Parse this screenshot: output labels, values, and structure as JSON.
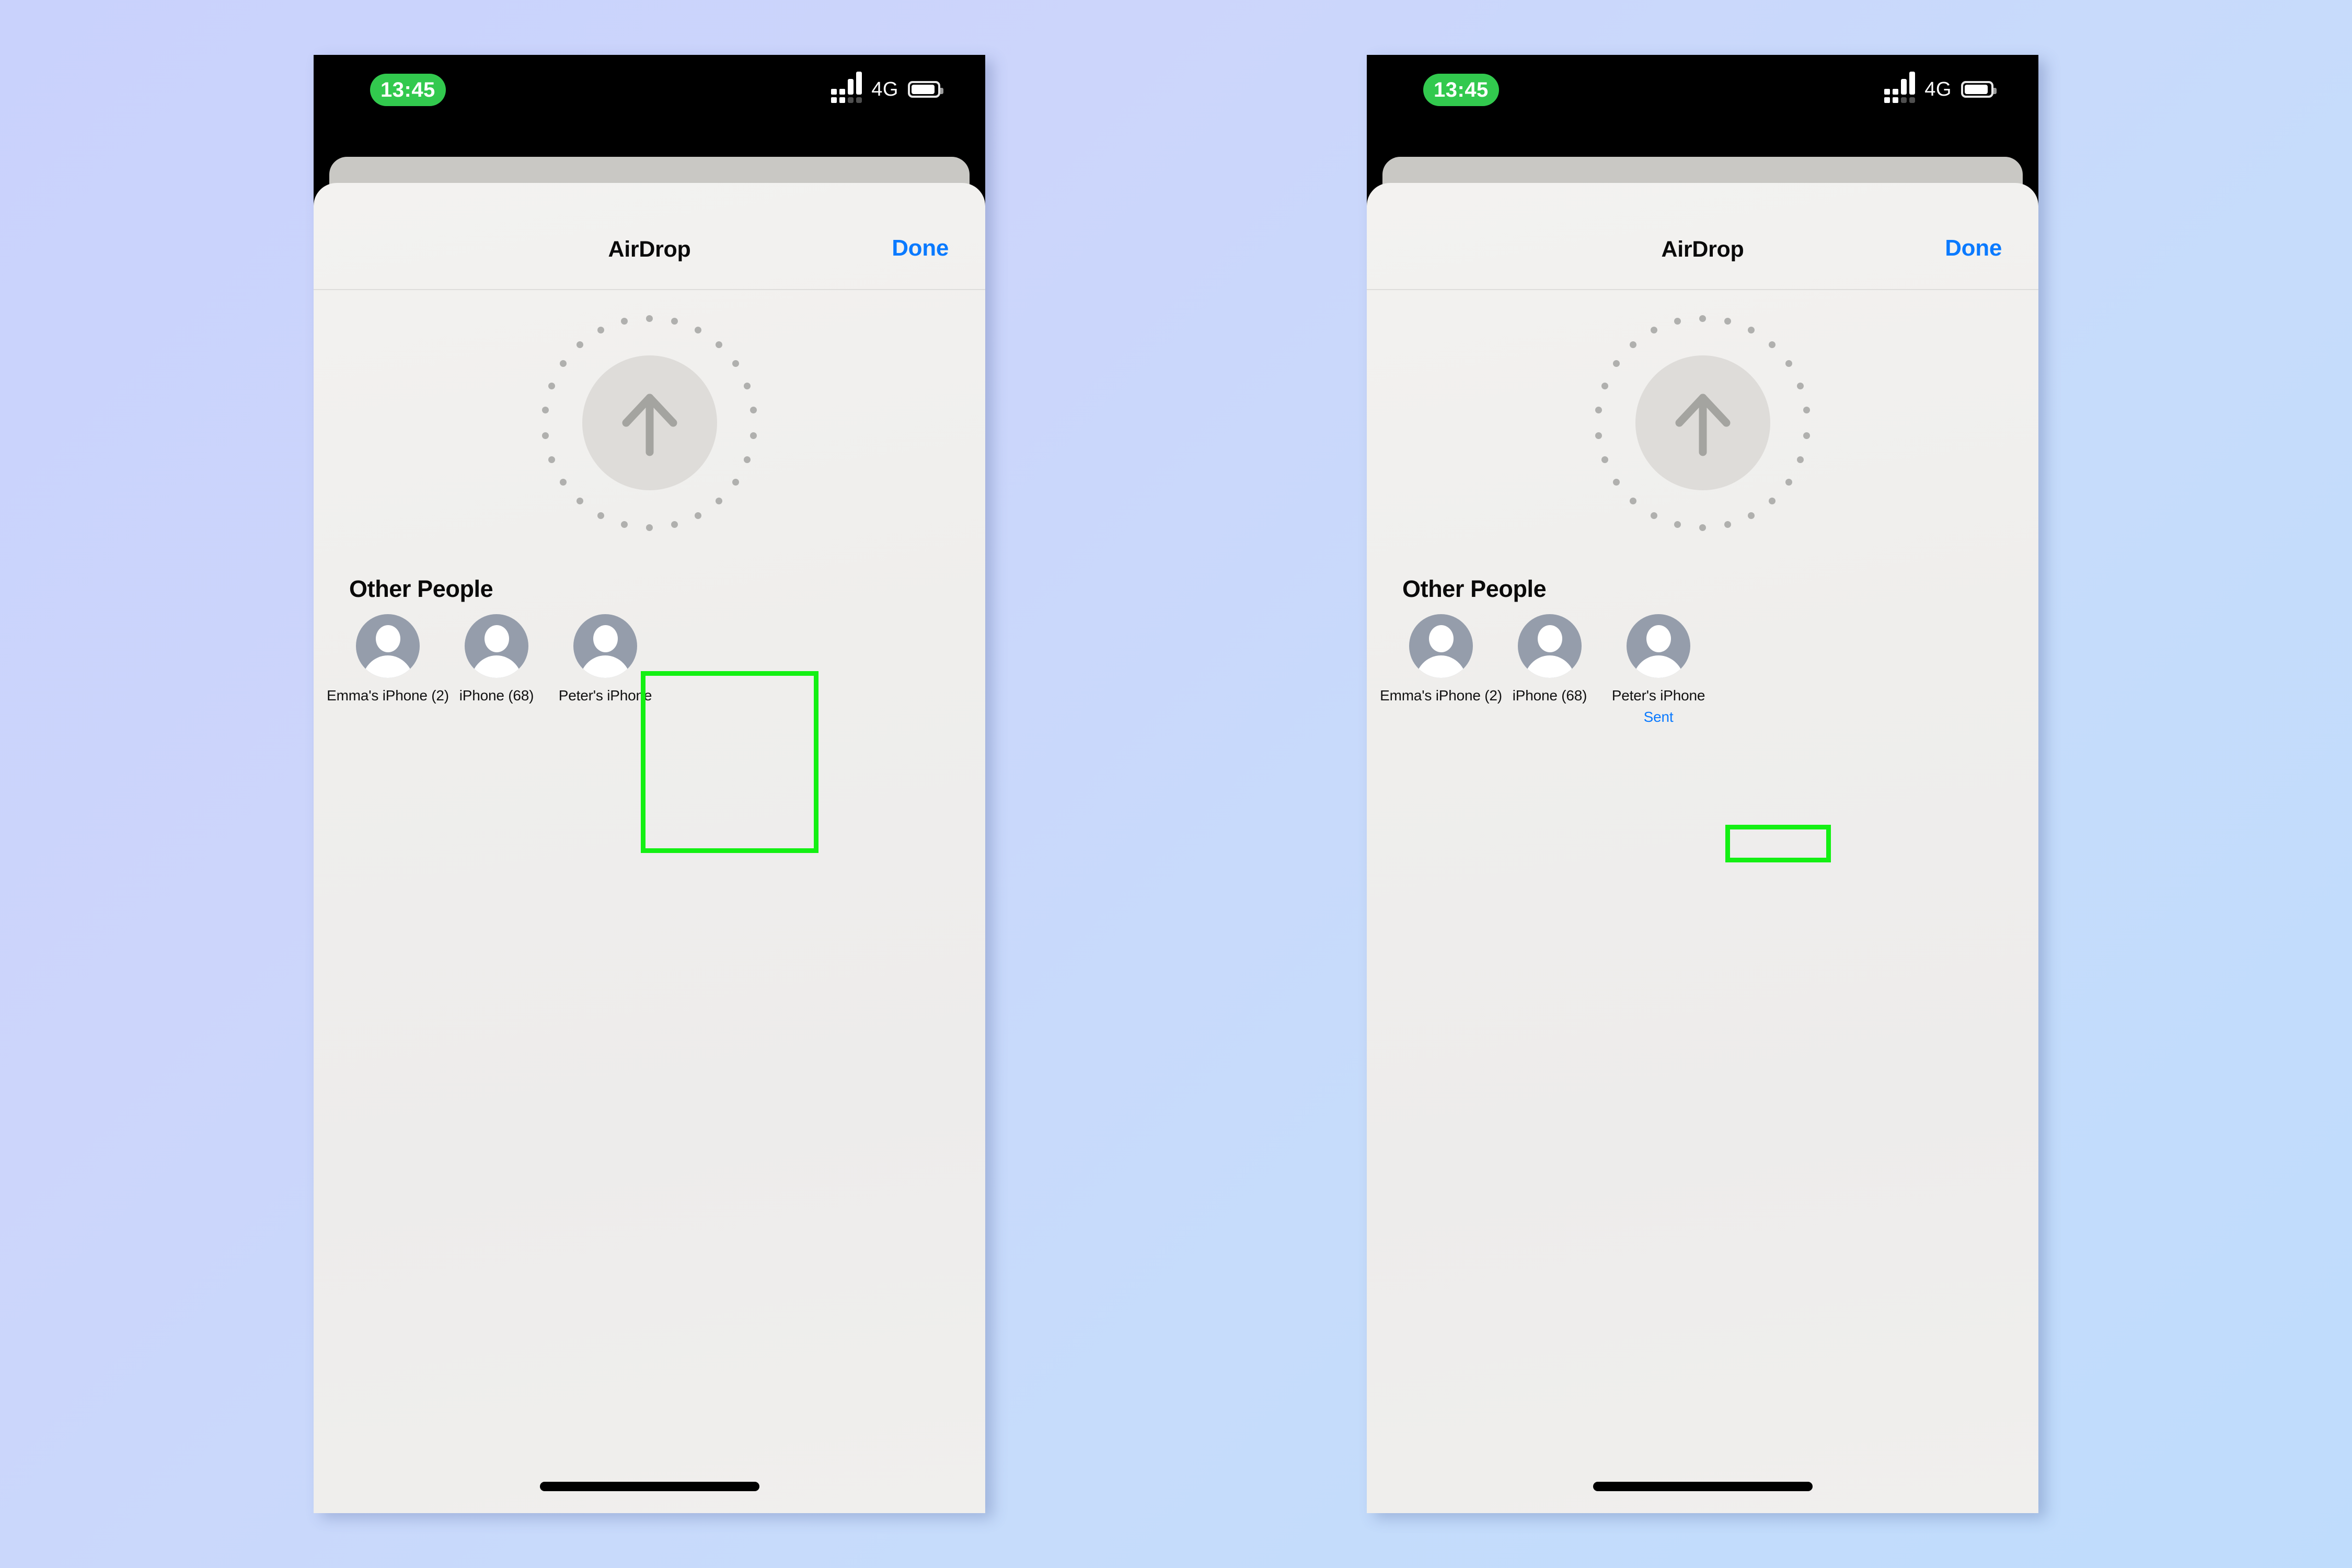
{
  "background": {
    "gradient_from": "#c9d2fc",
    "gradient_to": "#bfdcfc"
  },
  "annotation": {
    "color": "#13f013",
    "highlights": [
      {
        "name": "peter-iphone-target",
        "label": "Peter's iPhone"
      },
      {
        "name": "sent-status-target",
        "label": "Sent"
      }
    ]
  },
  "phones": [
    {
      "id": "phone-left",
      "statusbar": {
        "time": "13:45",
        "time_pill_color": "#32c94e",
        "network": "4G",
        "signal_icon": "signal-bars-icon",
        "battery_icon": "battery-icon",
        "battery_level_pct": 92
      },
      "sheet": {
        "title": "AirDrop",
        "done_label": "Done",
        "done_color": "#0a7aff",
        "radar": {
          "icon": "arrow-up-icon",
          "core_color": "#dedcd9",
          "arrow_color": "#a4a4a0",
          "dot_count": 26,
          "dot_color": "#b0b0ae"
        },
        "section_title": "Other People",
        "people": [
          {
            "name": "Emma's iPhone (2)",
            "status": ""
          },
          {
            "name": "iPhone (68)",
            "status": ""
          },
          {
            "name": "Peter's iPhone",
            "status": ""
          }
        ]
      },
      "home_indicator": true
    },
    {
      "id": "phone-right",
      "statusbar": {
        "time": "13:45",
        "time_pill_color": "#32c94e",
        "network": "4G",
        "signal_icon": "signal-bars-icon",
        "battery_icon": "battery-icon",
        "battery_level_pct": 92
      },
      "sheet": {
        "title": "AirDrop",
        "done_label": "Done",
        "done_color": "#0a7aff",
        "radar": {
          "icon": "arrow-up-icon",
          "core_color": "#dedcd9",
          "arrow_color": "#a4a4a0",
          "dot_count": 26,
          "dot_color": "#b0b0ae"
        },
        "section_title": "Other People",
        "people": [
          {
            "name": "Emma's iPhone (2)",
            "status": ""
          },
          {
            "name": "iPhone (68)",
            "status": ""
          },
          {
            "name": "Peter's iPhone",
            "status": "Sent"
          }
        ]
      },
      "home_indicator": true
    }
  ]
}
